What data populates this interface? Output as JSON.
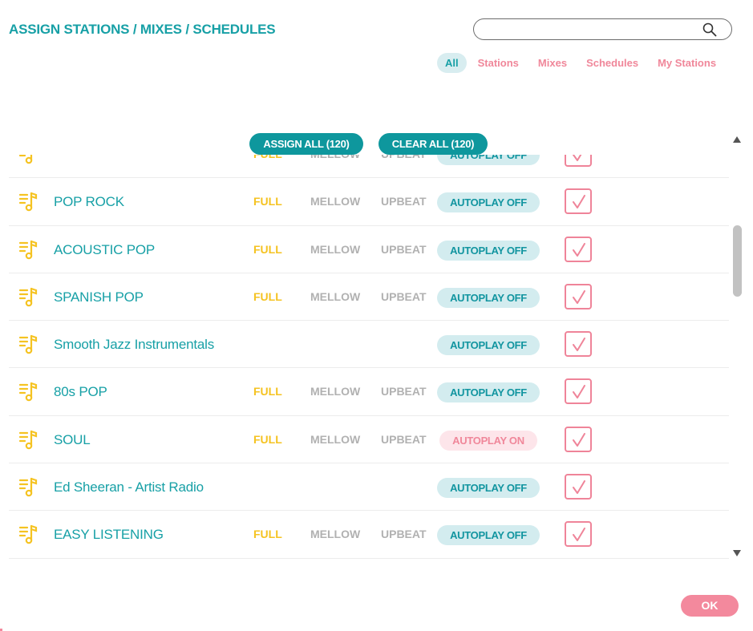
{
  "header": {
    "title": "ASSIGN STATIONS / MIXES / SCHEDULES"
  },
  "search": {
    "value": "",
    "icon": "search-icon"
  },
  "filters": [
    {
      "label": "All",
      "active": true
    },
    {
      "label": "Stations",
      "active": false
    },
    {
      "label": "Mixes",
      "active": false
    },
    {
      "label": "Schedules",
      "active": false
    },
    {
      "label": "My Stations",
      "active": false
    }
  ],
  "actions": {
    "assign_all": "ASSIGN ALL (120)",
    "clear_all": "CLEAR ALL (120)",
    "ok": "OK"
  },
  "colors": {
    "accent": "#17a0a6",
    "pink": "#f0879a",
    "full": "#f5c322",
    "muted": "#b1b1b1"
  },
  "stations": [
    {
      "name": "",
      "options": true,
      "autoplay": "AUTOPLAY OFF",
      "autoplay_on": false,
      "checked": true
    },
    {
      "name": "POP ROCK",
      "options": true,
      "autoplay": "AUTOPLAY OFF",
      "autoplay_on": false,
      "checked": true
    },
    {
      "name": "ACOUSTIC POP",
      "options": true,
      "autoplay": "AUTOPLAY OFF",
      "autoplay_on": false,
      "checked": true
    },
    {
      "name": "SPANISH POP",
      "options": true,
      "autoplay": "AUTOPLAY OFF",
      "autoplay_on": false,
      "checked": true
    },
    {
      "name": "Smooth Jazz Instrumentals",
      "options": false,
      "autoplay": "AUTOPLAY OFF",
      "autoplay_on": false,
      "checked": true
    },
    {
      "name": "80s POP",
      "options": true,
      "autoplay": "AUTOPLAY OFF",
      "autoplay_on": false,
      "checked": true
    },
    {
      "name": "SOUL",
      "options": true,
      "autoplay": "AUTOPLAY ON",
      "autoplay_on": true,
      "checked": true
    },
    {
      "name": "Ed Sheeran - Artist Radio",
      "options": false,
      "autoplay": "AUTOPLAY OFF",
      "autoplay_on": false,
      "checked": true
    },
    {
      "name": "EASY LISTENING",
      "options": true,
      "autoplay": "AUTOPLAY OFF",
      "autoplay_on": false,
      "checked": true
    }
  ],
  "option_labels": {
    "full": "FULL",
    "mellow": "MELLOW",
    "upbeat": "UPBEAT"
  }
}
